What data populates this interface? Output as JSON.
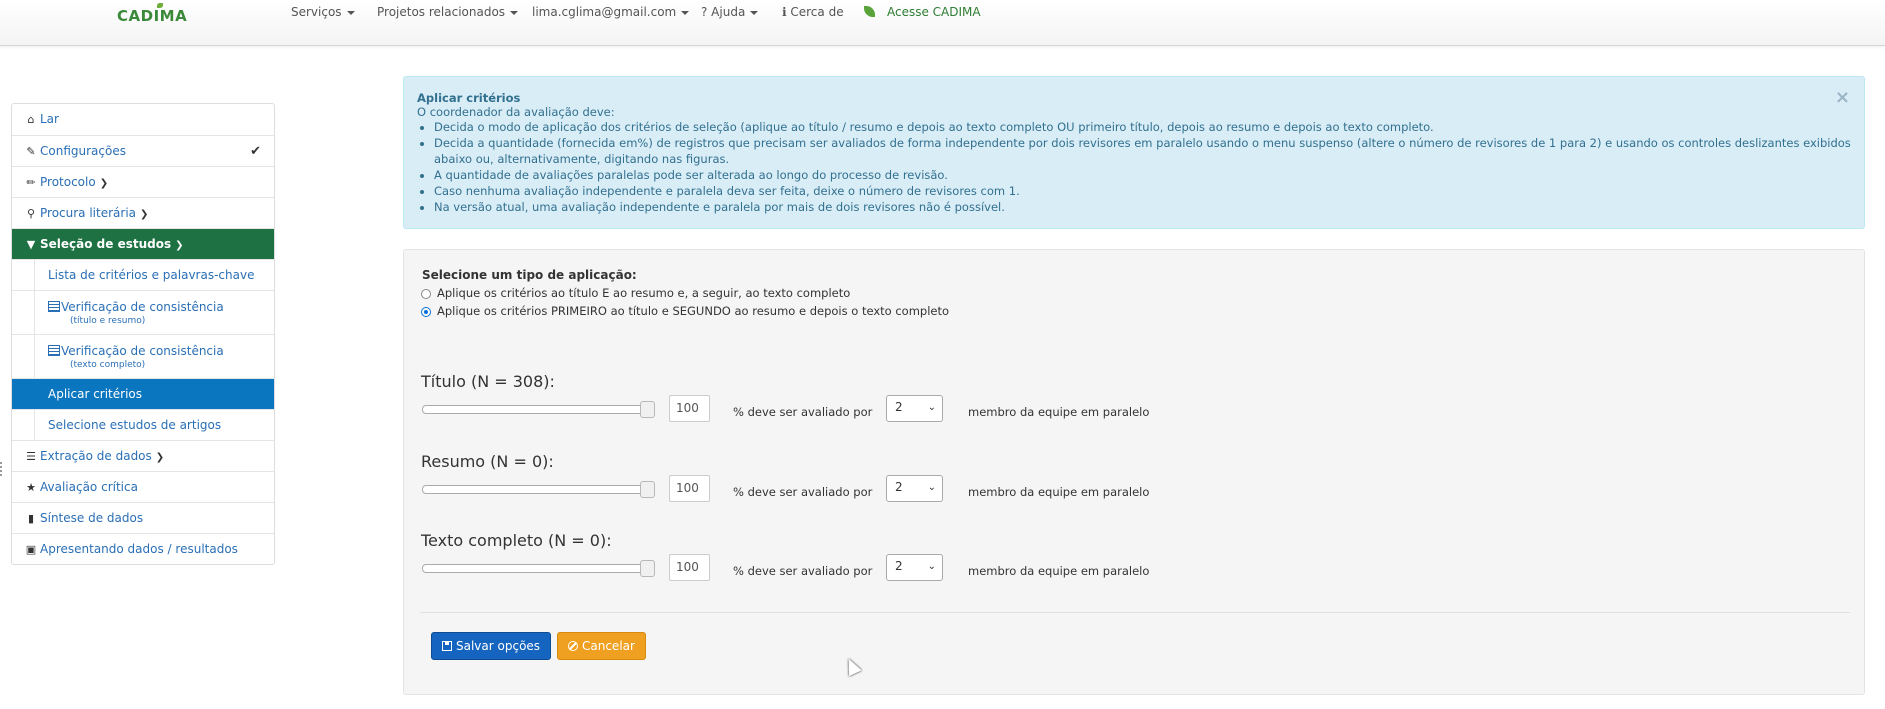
{
  "navbar": {
    "brand": "CADIMA",
    "items": [
      {
        "label": "Serviços"
      },
      {
        "label": "Projetos relacionados"
      },
      {
        "label": "lima.cglima@gmail.com"
      },
      {
        "label": "? Ajuda"
      },
      {
        "label": "ℹ Cerca de"
      },
      {
        "label": "Acesse CADIMA"
      }
    ]
  },
  "sidebar": {
    "items": [
      {
        "label": "Lar",
        "icon": "home-icon"
      },
      {
        "label": "Configurações",
        "icon": "wrench-icon"
      },
      {
        "label": "Protocolo",
        "icon": "pencil-icon"
      },
      {
        "label": "Procura literária",
        "icon": "search-icon"
      },
      {
        "label": "Seleção de estudos",
        "icon": "filter-icon"
      },
      {
        "label": "Extração de dados",
        "icon": "list-icon"
      },
      {
        "label": "Avaliação crítica",
        "icon": "star-icon"
      },
      {
        "label": "Síntese de dados",
        "icon": "file-icon"
      },
      {
        "label": "Apresentando dados / resultados",
        "icon": "image-icon"
      }
    ],
    "subitems": [
      {
        "label": "Lista de critérios e palavras-chave"
      },
      {
        "label": "Verificação de consistência",
        "sub": "(título e resumo)"
      },
      {
        "label": "Verificação de consistência",
        "sub": "(texto completo)"
      },
      {
        "label": "Aplicar critérios"
      },
      {
        "label": "Selecione estudos de artigos"
      }
    ]
  },
  "alert": {
    "title": "Aplicar critérios",
    "intro": "O coordenador da avaliação deve:",
    "bullets": [
      "Decida o modo de aplicação dos critérios de seleção (aplique ao título / resumo e depois ao texto completo OU primeiro título, depois ao resumo e depois ao texto completo.",
      "Decida a quantidade (fornecida em%) de registros que precisam ser avaliados de forma independente por dois revisores em paralelo usando o menu suspenso (altere o número de revisores de 1 para 2) e usando os controles deslizantes exibidos abaixo ou, alternativamente, digitando nas figuras.",
      "A quantidade de avaliações paralelas pode ser alterada ao longo do processo de revisão.",
      "Caso nenhuma avaliação independente e paralela deva ser feita, deixe o número de revisores com 1.",
      "Na versão atual, uma avaliação independente e paralela por mais de dois revisores não é possível."
    ],
    "close": "×"
  },
  "form": {
    "type_label": "Selecione um tipo de aplicação:",
    "options": [
      {
        "label": "Aplique os critérios ao título E ao resumo e, a seguir, ao texto completo",
        "selected": false
      },
      {
        "label": "Aplique os critérios PRIMEIRO ao título e SEGUNDO ao resumo e depois o texto completo",
        "selected": true
      }
    ],
    "groups": [
      {
        "title": "Título (N = 308):",
        "percent": "100",
        "mid_text": "% deve ser avaliado por",
        "reviewers": "2",
        "end_text": "membro da equipe em paralelo"
      },
      {
        "title": "Resumo (N = 0):",
        "percent": "100",
        "mid_text": "% deve ser avaliado por",
        "reviewers": "2",
        "end_text": "membro da equipe em paralelo"
      },
      {
        "title": "Texto completo (N = 0):",
        "percent": "100",
        "mid_text": "% deve ser avaliado por",
        "reviewers": "2",
        "end_text": "membro da equipe em paralelo"
      }
    ],
    "save_label": "Salvar opções",
    "cancel_label": "Cancelar"
  }
}
